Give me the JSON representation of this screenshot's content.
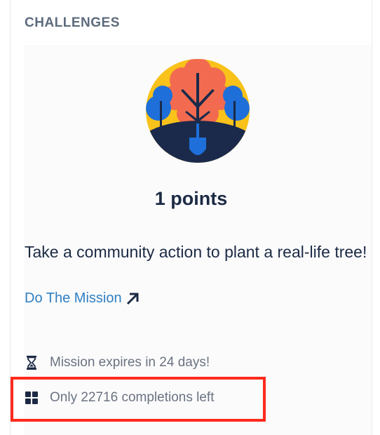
{
  "section": {
    "title": "CHALLENGES"
  },
  "challenge": {
    "badge_icon": "tree-planting-badge-icon",
    "points_label": "1 points",
    "description": "Take a community action to plant a real-life tree!",
    "link_label": "Do The Mission",
    "link_icon": "arrow-up-right-icon"
  },
  "meta": {
    "expires_text": "Mission expires in 24 days!",
    "expires_icon": "hourglass-icon",
    "completions_text": "Only 22716 completions left",
    "completions_icon": "grid-icon"
  },
  "colors": {
    "accent_link": "#2f7fc1",
    "highlight": "#ff2b1c",
    "badge_bg": "#f8c21a",
    "badge_tree": "#f26b50",
    "badge_blue": "#1e6fd9",
    "badge_ground": "#1b2a4a"
  }
}
